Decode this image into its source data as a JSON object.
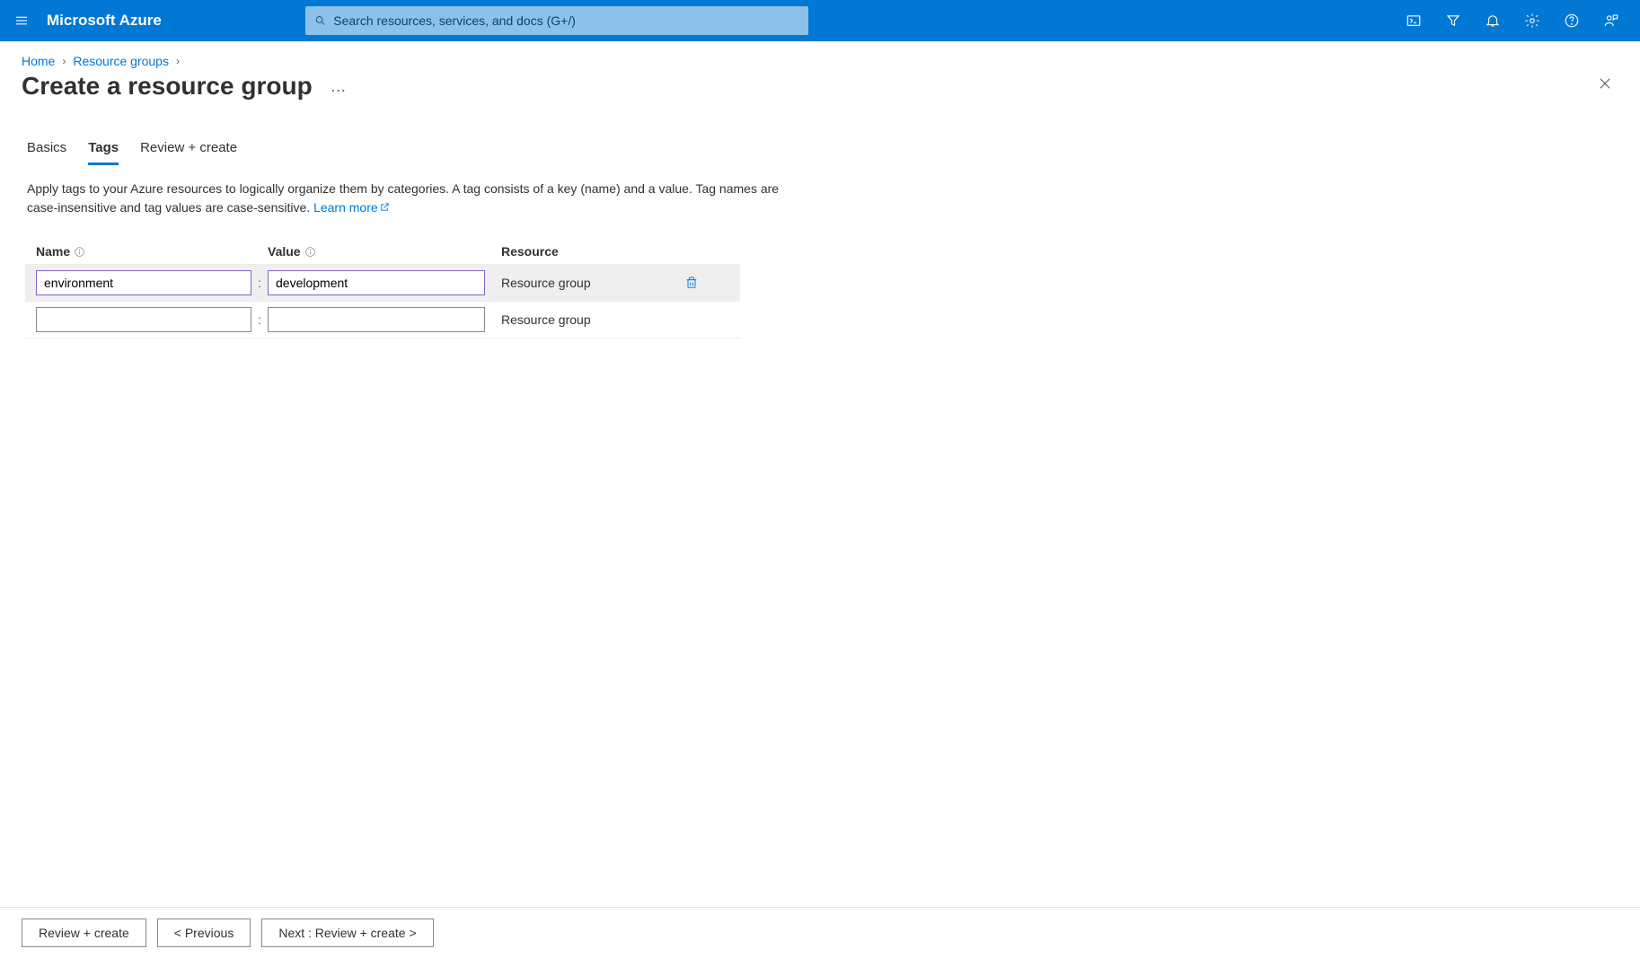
{
  "header": {
    "brand": "Microsoft Azure",
    "search_placeholder": "Search resources, services, and docs (G+/)"
  },
  "breadcrumb": {
    "items": [
      "Home",
      "Resource groups"
    ]
  },
  "page": {
    "title": "Create a resource group"
  },
  "tabs": {
    "items": [
      {
        "label": "Basics",
        "active": false
      },
      {
        "label": "Tags",
        "active": true
      },
      {
        "label": "Review + create",
        "active": false
      }
    ]
  },
  "description": {
    "text": "Apply tags to your Azure resources to logically organize them by categories. A tag consists of a key (name) and a value. Tag names are case-insensitive and tag values are case-sensitive. ",
    "link_label": "Learn more"
  },
  "tags_table": {
    "headers": {
      "name": "Name",
      "value": "Value",
      "resource": "Resource"
    },
    "rows": [
      {
        "name": "environment",
        "value": "development",
        "resource": "Resource group",
        "deletable": true
      },
      {
        "name": "",
        "value": "",
        "resource": "Resource group",
        "deletable": false
      }
    ]
  },
  "footer": {
    "review_create": "Review + create",
    "previous": "< Previous",
    "next": "Next : Review + create >"
  }
}
